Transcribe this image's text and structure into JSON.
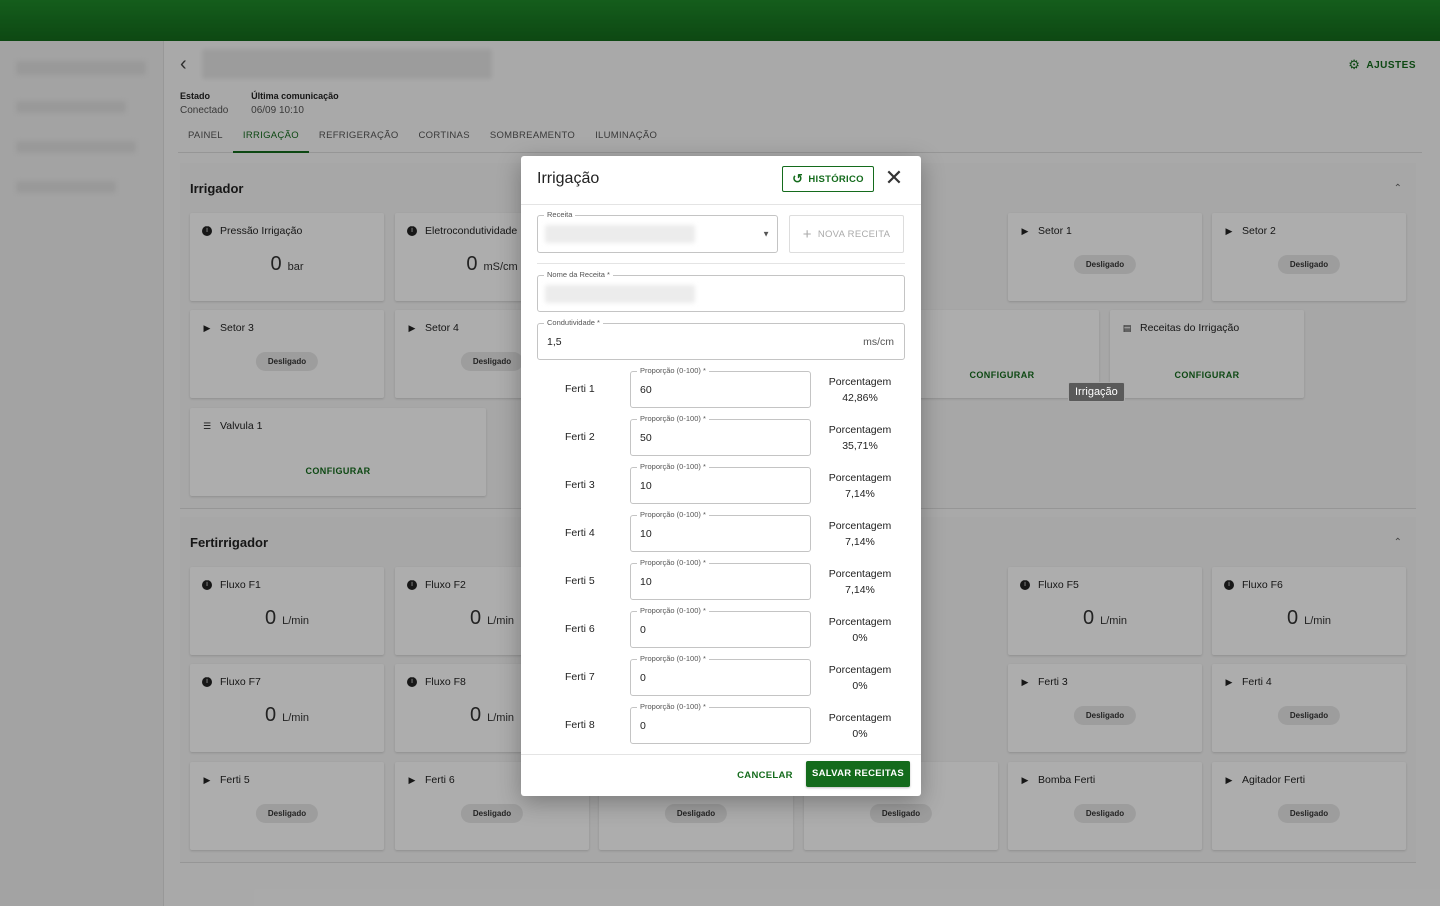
{
  "header": {
    "settings_label": "AJUSTES"
  },
  "status": {
    "state_label": "Estado",
    "state_value": "Conectado",
    "last_comm_label": "Última comunicação",
    "last_comm_value": "06/09 10:10"
  },
  "tabs": [
    "PAINEL",
    "IRRIGAÇÃO",
    "REFRIGERAÇÃO",
    "CORTINAS",
    "SOMBREAMENTO",
    "ILUMINAÇÃO"
  ],
  "irrigador": {
    "title": "Irrigador",
    "cards": [
      {
        "title": "Pressão Irrigação",
        "value": "0",
        "unit": "bar"
      },
      {
        "title": "Eletrocondutividade",
        "value": "0",
        "unit": "mS/cm"
      },
      {
        "title": "Setor 1",
        "chip": "Desligado"
      },
      {
        "title": "Setor 2",
        "chip": "Desligado"
      },
      {
        "title": "Setor 3",
        "chip": "Desligado"
      },
      {
        "title": "Setor 4",
        "chip": "Desligado"
      },
      {
        "cfg": "CONFIGURAR"
      },
      {
        "title": "Receitas do Irrigação",
        "cfg": "CONFIGURAR"
      },
      {
        "title": "Valvula 1",
        "cfg": "CONFIGURAR"
      }
    ]
  },
  "fertirrigador": {
    "title": "Fertirrigador",
    "cards": [
      {
        "title": "Fluxo F1",
        "value": "0",
        "unit": "L/min"
      },
      {
        "title": "Fluxo F2",
        "value": "0",
        "unit": "L/min"
      },
      {
        "title": "Fluxo F5",
        "value": "0",
        "unit": "L/min"
      },
      {
        "title": "Fluxo F6",
        "value": "0",
        "unit": "L/min"
      },
      {
        "title": "Fluxo F7",
        "value": "0",
        "unit": "L/min"
      },
      {
        "title": "Fluxo F8",
        "value": "0",
        "unit": "L/min"
      },
      {
        "title": "Ferti 3",
        "chip": "Desligado"
      },
      {
        "title": "Ferti 4",
        "chip": "Desligado"
      },
      {
        "title": "Ferti 5",
        "chip": "Desligado"
      },
      {
        "title": "Ferti 6",
        "chip": "Desligado"
      },
      {
        "chip": "Desligado"
      },
      {
        "chip": "Desligado"
      },
      {
        "title": "Bomba Ferti",
        "chip": "Desligado"
      },
      {
        "title": "Agitador Ferti",
        "chip": "Desligado"
      }
    ]
  },
  "tooltip": "Irrigação",
  "dialog": {
    "title": "Irrigação",
    "history_label": "HISTÓRICO",
    "recipe_label": "Receita",
    "new_recipe_label": "NOVA RECEITA",
    "recipe_name_label": "Nome da Receita *",
    "conductivity_label": "Condutividade *",
    "conductivity_value": "1,5",
    "conductivity_unit": "ms/cm",
    "proportion_label": "Proporção (0-100) *",
    "percent_label": "Porcentagem",
    "fertis": [
      {
        "name": "Ferti 1",
        "value": "60",
        "pct": "42,86%"
      },
      {
        "name": "Ferti 2",
        "value": "50",
        "pct": "35,71%"
      },
      {
        "name": "Ferti 3",
        "value": "10",
        "pct": "7,14%"
      },
      {
        "name": "Ferti 4",
        "value": "10",
        "pct": "7,14%"
      },
      {
        "name": "Ferti 5",
        "value": "10",
        "pct": "7,14%"
      },
      {
        "name": "Ferti 6",
        "value": "0",
        "pct": "0%"
      },
      {
        "name": "Ferti 7",
        "value": "0",
        "pct": "0%"
      },
      {
        "name": "Ferti 8",
        "value": "0",
        "pct": "0%"
      }
    ],
    "cancel_label": "CANCELAR",
    "save_label": "SALVAR RECEITAS"
  }
}
